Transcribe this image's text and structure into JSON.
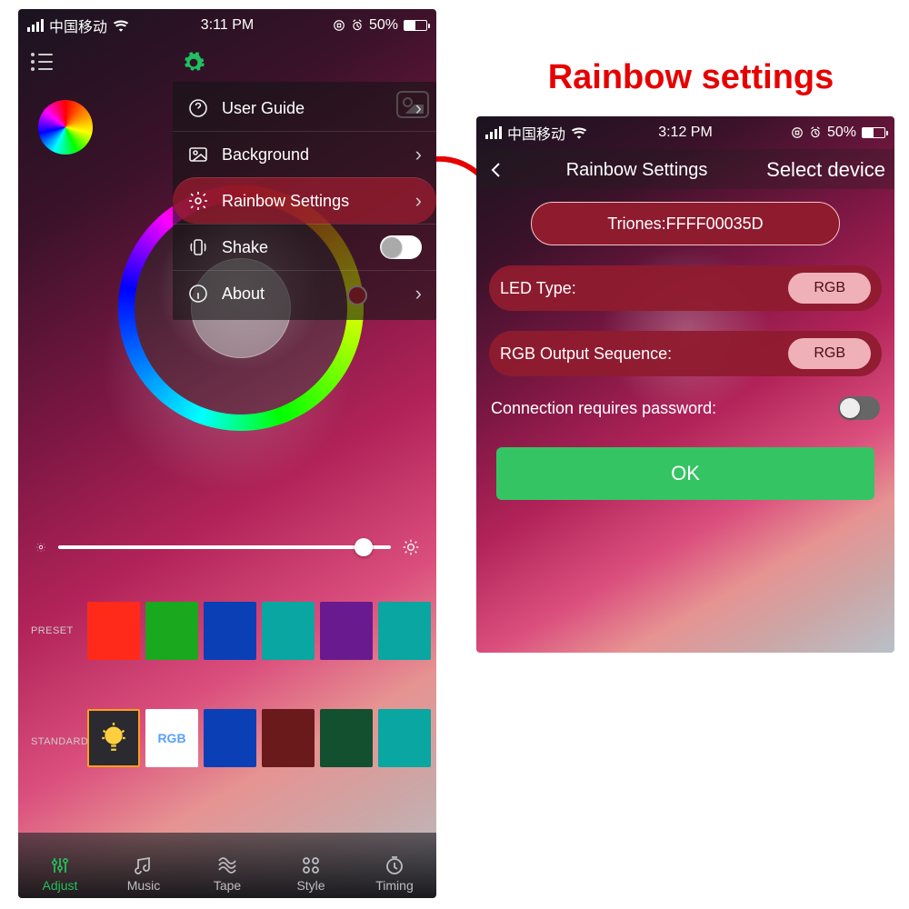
{
  "annotation": {
    "title": "Rainbow settings",
    "color": "#e60000"
  },
  "status": {
    "carrier": "中国移动",
    "a_time": "3:11 PM",
    "b_time": "3:12 PM",
    "battery_percent": "50%"
  },
  "phoneA": {
    "menu": {
      "items": [
        {
          "icon": "question-icon",
          "label": "User Guide",
          "action": "chevron"
        },
        {
          "icon": "image-icon",
          "label": "Background",
          "action": "chevron"
        },
        {
          "icon": "gear-icon",
          "label": "Rainbow Settings",
          "action": "chevron",
          "active": true
        },
        {
          "icon": "vibrate-icon",
          "label": "Shake",
          "action": "toggle",
          "toggle_on": false
        },
        {
          "icon": "info-icon",
          "label": "About",
          "action": "chevron"
        }
      ]
    },
    "brightness": {
      "value_pct": 92
    },
    "preset_label": "PRESET",
    "standard_label": "STANDARD",
    "preset_colors": [
      "#ff2a1a",
      "#19a81e",
      "#0a3fb6",
      "#0aa6a1",
      "#6a1a8f",
      "#0aa6a1"
    ],
    "standard_colors": [
      "bulb",
      "RGB",
      "#0a3fb6",
      "#6a1a1a",
      "#12502f",
      "#0aa6a1"
    ],
    "standard_rgb_label": "RGB",
    "tabs": [
      {
        "name": "adjust",
        "label": "Adjust"
      },
      {
        "name": "music",
        "label": "Music"
      },
      {
        "name": "tape",
        "label": "Tape"
      },
      {
        "name": "style",
        "label": "Style"
      },
      {
        "name": "timing",
        "label": "Timing"
      }
    ],
    "tabs_active": "adjust"
  },
  "phoneB": {
    "header": {
      "title": "Rainbow Settings",
      "right": "Select device"
    },
    "device": "Triones:FFFF00035D",
    "led_type_label": "LED Type:",
    "led_type_value": "RGB",
    "seq_label": "RGB Output Sequence:",
    "seq_value": "RGB",
    "pwd_label": "Connection requires password:",
    "pwd_toggle_on": false,
    "ok_label": "OK"
  }
}
